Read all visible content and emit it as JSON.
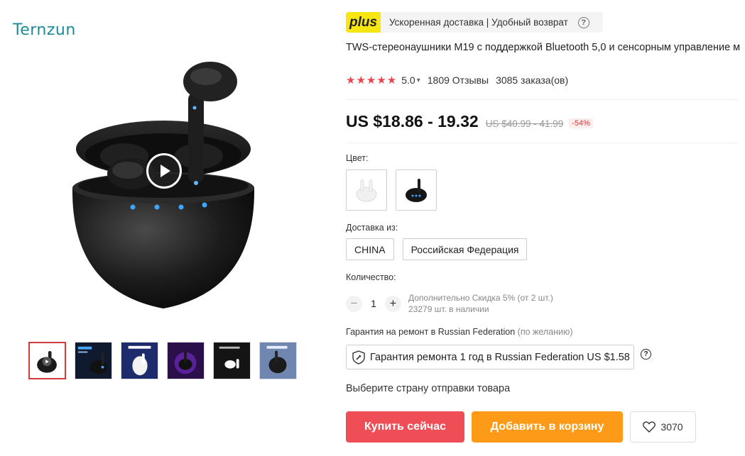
{
  "brand": {
    "logo_text": "Ternzun"
  },
  "gallery": {
    "thumbnails": [
      {
        "name": "thumb-1",
        "active": true
      },
      {
        "name": "thumb-2",
        "active": false
      },
      {
        "name": "thumb-3",
        "active": false
      },
      {
        "name": "thumb-4",
        "active": false
      },
      {
        "name": "thumb-5",
        "active": false
      },
      {
        "name": "thumb-6",
        "active": false
      }
    ],
    "play_icon": "play-icon"
  },
  "plus": {
    "badge": "plus",
    "text": "Ускоренная доставка | Удобный возврат",
    "help_icon": "?"
  },
  "product": {
    "title": "TWS-стереонаушники M19 с поддержкой Bluetooth 5,0 и сенсорным управление м",
    "stars": "★★★★★",
    "rating": "5.0",
    "reviews": "1809 Отзывы",
    "orders": "3085 заказа(ов)"
  },
  "price": {
    "current": "US $18.86 - 19.32",
    "old": "US $40.99 - 41.99",
    "discount": "-54%"
  },
  "color": {
    "label": "Цвет:",
    "options": [
      "white",
      "black"
    ]
  },
  "shipping": {
    "label": "Доставка из:",
    "options": [
      "CHINA",
      "Российская Федерация"
    ]
  },
  "quantity": {
    "label": "Количество:",
    "minus": "−",
    "value": "1",
    "plus": "+",
    "discount_note": "Дополнительно Скидка 5% (от 2 шт.)",
    "stock": "23279 шт. в наличии"
  },
  "warranty": {
    "label": "Гарантия на ремонт в Russian Federation",
    "optional": "(по желанию)",
    "option_text": "Гарантия ремонта 1 год в Russian Federation US $1.58",
    "help_icon": "?"
  },
  "choose_country": "Выберите страну отправки товара",
  "actions": {
    "buy_now": "Купить сейчас",
    "add_to_cart": "Добавить в корзину",
    "wishlist_count": "3070"
  },
  "colors": {
    "buy": "#f04e57",
    "cart": "#fd9a18",
    "plus_badge": "#f7e610",
    "stars": "#e9434b"
  }
}
